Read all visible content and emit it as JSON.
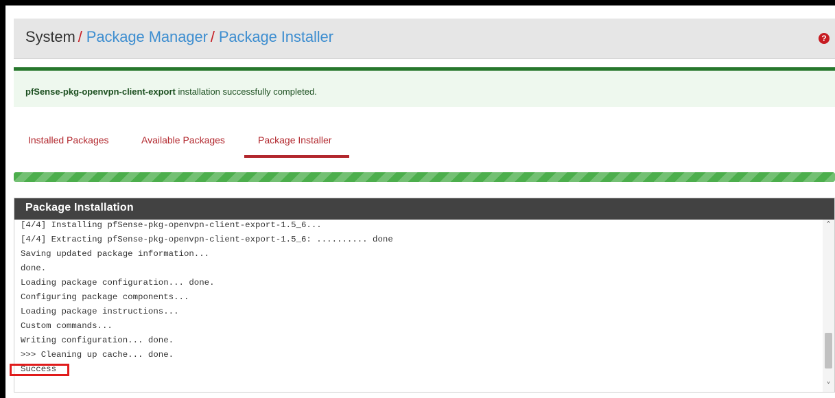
{
  "breadcrumb": {
    "root": "System",
    "separator": "/",
    "level1": "Package Manager",
    "level2": "Package Installer"
  },
  "header": {
    "help_icon": "question-circle-icon"
  },
  "alert": {
    "package_name": "pfSense-pkg-openvpn-client-export",
    "message": " installation successfully completed."
  },
  "tabs": [
    {
      "label": "Installed Packages",
      "active": false
    },
    {
      "label": "Available Packages",
      "active": false
    },
    {
      "label": "Package Installer",
      "active": true
    }
  ],
  "progress": {
    "percent": 100,
    "color": "#4cae4c"
  },
  "panel": {
    "title": "Package Installation",
    "log_lines": [
      "[4/4] Installing pfSense-pkg-openvpn-client-export-1.5_6...",
      "[4/4] Extracting pfSense-pkg-openvpn-client-export-1.5_6: .......... done",
      "Saving updated package information...",
      "done.",
      "Loading package configuration... done.",
      "Configuring package components...",
      "Loading package instructions...",
      "Custom commands...",
      "Writing configuration... done.",
      ">>> Cleaning up cache... done.",
      "Success"
    ]
  },
  "colors": {
    "accent_red": "#b2272d",
    "link_blue": "#3e8ed0",
    "success_green": "#27772d",
    "panel_heading": "#424242"
  }
}
